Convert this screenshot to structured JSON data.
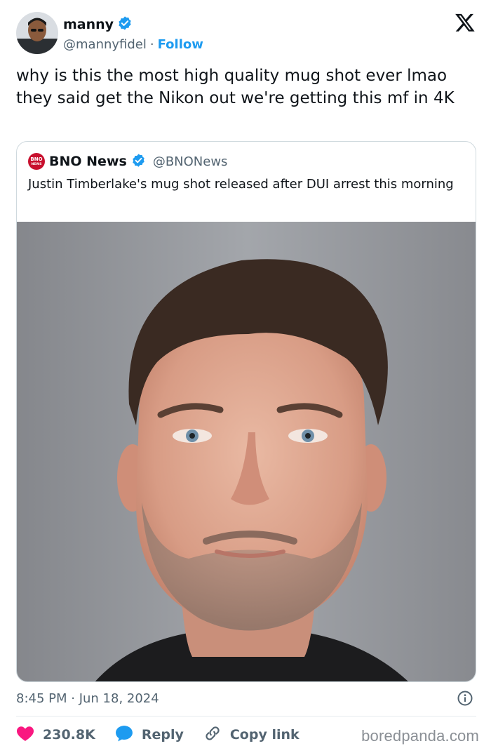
{
  "author": {
    "display_name": "manny",
    "handle": "@mannyfidel",
    "separator": "·",
    "follow_label": "Follow",
    "verified": true
  },
  "tweet": {
    "text": "why is this the most high quality mug shot ever lmao they said get the Nikon out we're getting this mf in 4K",
    "timestamp": "8:45 PM · Jun 18, 2024"
  },
  "quote": {
    "logo_text_top": "BNO",
    "logo_text_bottom": "NEWS",
    "display_name": "BNO News",
    "handle": "@BNONews",
    "verified": true,
    "text": "Justin Timberlake's mug shot released after DUI arrest this morning",
    "photo_icon": "mug-shot-photo"
  },
  "actions": {
    "likes": "230.8K",
    "reply_label": "Reply",
    "copy_label": "Copy link"
  },
  "watermark": "boredpanda.com",
  "colors": {
    "accent": "#1d9bf0",
    "like": "#f91880",
    "text": "#0f1419",
    "muted": "#536471",
    "border": "#cfd9de",
    "bno_red": "#c8102e"
  }
}
